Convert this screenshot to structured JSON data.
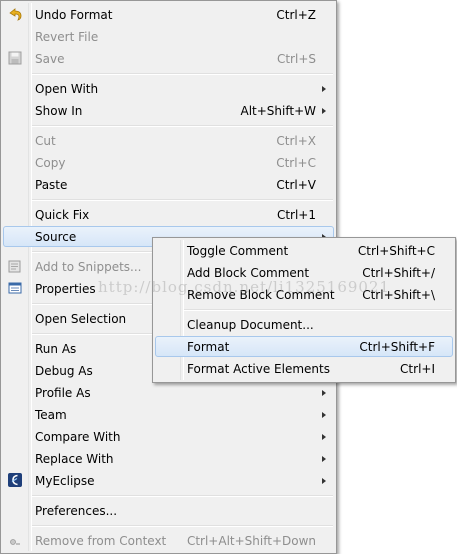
{
  "main_menu": {
    "undo_format": {
      "label": "Undo Format",
      "shortcut": "Ctrl+Z",
      "icon": "undo-icon"
    },
    "revert_file": {
      "label": "Revert File"
    },
    "save": {
      "label": "Save",
      "shortcut": "Ctrl+S",
      "icon": "save-icon"
    },
    "open_with": {
      "label": "Open With"
    },
    "show_in": {
      "label": "Show In",
      "shortcut": "Alt+Shift+W"
    },
    "cut": {
      "label": "Cut",
      "shortcut": "Ctrl+X"
    },
    "copy": {
      "label": "Copy",
      "shortcut": "Ctrl+C"
    },
    "paste": {
      "label": "Paste",
      "shortcut": "Ctrl+V"
    },
    "quick_fix": {
      "label": "Quick Fix",
      "shortcut": "Ctrl+1"
    },
    "source": {
      "label": "Source"
    },
    "add_to_snippets": {
      "label": "Add to Snippets...",
      "icon": "snippets-icon"
    },
    "properties": {
      "label": "Properties",
      "icon": "properties-icon"
    },
    "open_selection": {
      "label": "Open Selection"
    },
    "run_as": {
      "label": "Run As"
    },
    "debug_as": {
      "label": "Debug As"
    },
    "profile_as": {
      "label": "Profile As"
    },
    "team": {
      "label": "Team"
    },
    "compare_with": {
      "label": "Compare With"
    },
    "replace_with": {
      "label": "Replace With"
    },
    "myeclipse": {
      "label": "MyEclipse",
      "icon": "myeclipse-icon"
    },
    "preferences": {
      "label": "Preferences..."
    },
    "remove_from_context": {
      "label": "Remove from Context",
      "shortcut": "Ctrl+Alt+Shift+Down",
      "icon": "remove-context-icon"
    }
  },
  "source_submenu": {
    "toggle_comment": {
      "label": "Toggle Comment",
      "shortcut": "Ctrl+Shift+C"
    },
    "add_block_comment": {
      "label": "Add Block Comment",
      "shortcut": "Ctrl+Shift+/"
    },
    "remove_block_comment": {
      "label": "Remove Block Comment",
      "shortcut": "Ctrl+Shift+\\"
    },
    "cleanup_document": {
      "label": "Cleanup Document..."
    },
    "format": {
      "label": "Format",
      "shortcut": "Ctrl+Shift+F"
    },
    "format_active_elements": {
      "label": "Format Active Elements",
      "shortcut": "Ctrl+I"
    }
  },
  "watermark": "http://blog.csdn.net/li1325169021",
  "colors": {
    "menu_bg": "#f0f0f0",
    "highlight_border": "#a8c8ec",
    "disabled_text": "#8e8e8e"
  }
}
